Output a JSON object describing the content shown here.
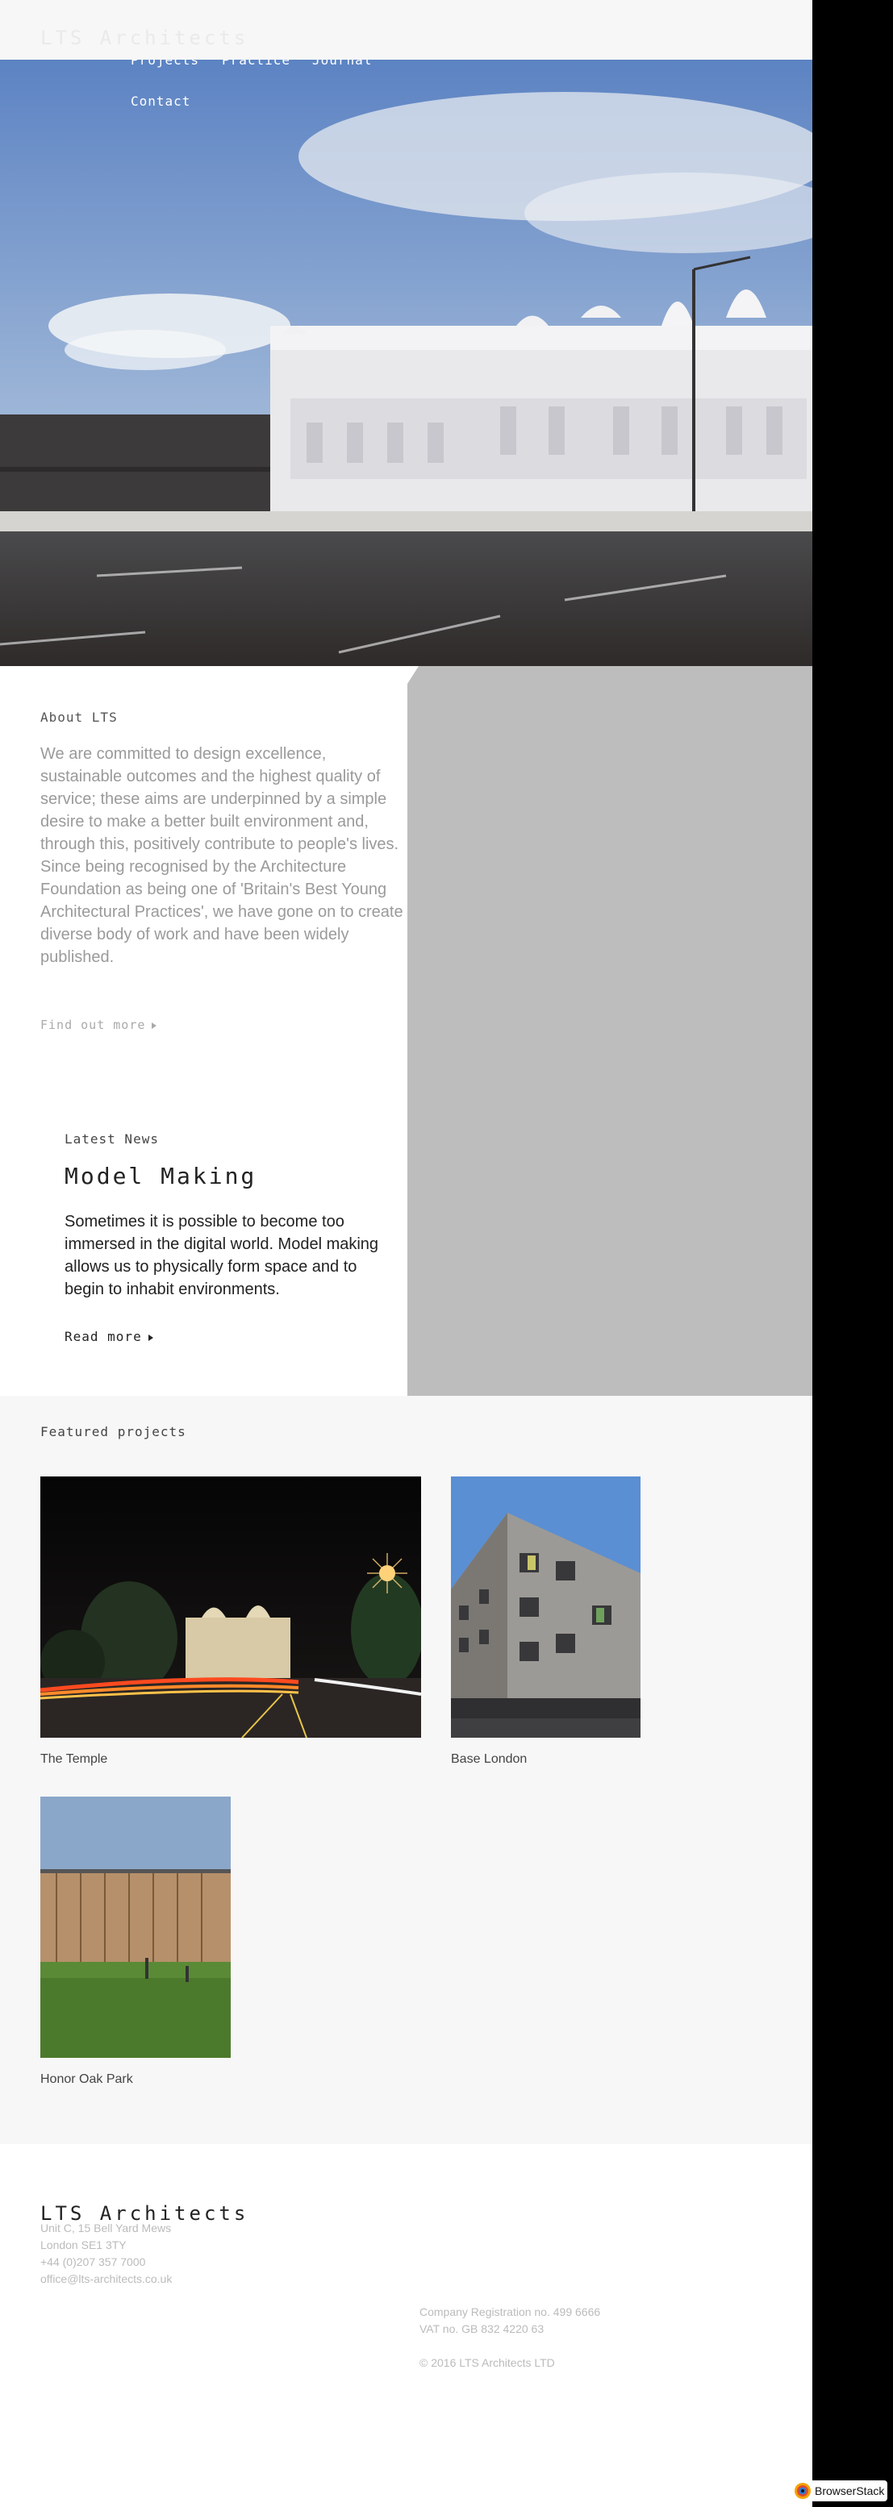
{
  "header": {
    "logo": "LTS Architects"
  },
  "nav": {
    "items": [
      "Projects",
      "Practice",
      "Journal",
      "Contact"
    ]
  },
  "about": {
    "title": "About LTS",
    "body": "We are committed to design excellence, sustainable outcomes and the highest quality of service; these aims are underpinned by a simple desire to make a better built environment and, through this, positively contribute to people's lives. Since being recognised by the Architecture Foundation as being one of 'Britain's Best Young Architectural Practices', we have gone on to create diverse body of work and have been widely published.",
    "link": "Find out more"
  },
  "news": {
    "label": "Latest News",
    "title": "Model Making",
    "body": "Sometimes it is possible to become too immersed in the digital world. Model making allows us to physically form space and to begin to inhabit environments.",
    "link": "Read more"
  },
  "featured": {
    "title": "Featured projects",
    "projects": [
      {
        "name": "The Temple"
      },
      {
        "name": "Base London"
      },
      {
        "name": "Honor Oak Park"
      }
    ]
  },
  "footer": {
    "logo": "LTS Architects",
    "address": [
      "Unit C, 15 Bell Yard Mews",
      "London SE1 3TY",
      "+44 (0)207 357 7000",
      "office@lts-architects.co.uk"
    ],
    "company": [
      "Company Registration no. 499 6666",
      "VAT no. GB 832 4220 63",
      "© 2016 LTS Architects LTD"
    ]
  },
  "browserstack": {
    "label": "BrowserStack"
  }
}
